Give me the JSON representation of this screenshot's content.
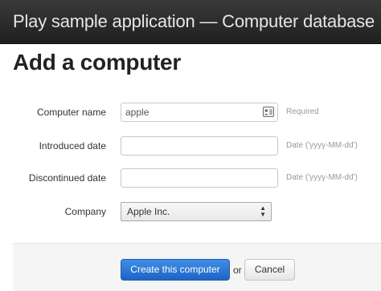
{
  "header": {
    "title": "Play sample application — Computer database"
  },
  "page": {
    "heading": "Add a computer"
  },
  "form": {
    "computer_name": {
      "label": "Computer name",
      "value": "apple",
      "help": "Required"
    },
    "introduced": {
      "label": "Introduced date",
      "value": "",
      "help": "Date ('yyyy-MM-dd')"
    },
    "discontinued": {
      "label": "Discontinued date",
      "value": "",
      "help": "Date ('yyyy-MM-dd')"
    },
    "company": {
      "label": "Company",
      "selected": "Apple Inc."
    }
  },
  "actions": {
    "submit_label": "Create this computer",
    "or_text": "or",
    "cancel_label": "Cancel"
  },
  "icons": {
    "autofill": "contact-card-icon",
    "select_arrows": "up-down-arrows-icon"
  }
}
